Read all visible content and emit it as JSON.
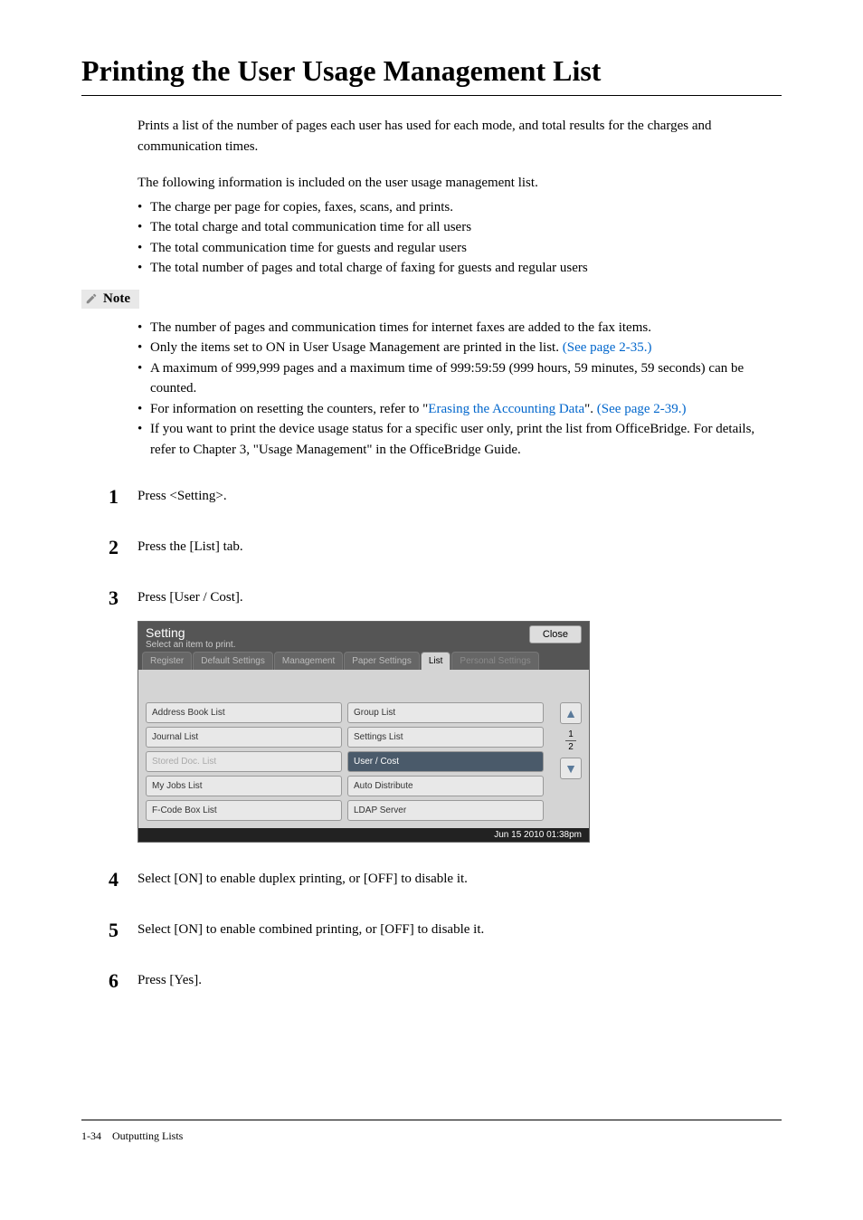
{
  "title": "Printing the User Usage Management List",
  "intro": "Prints a list of the number of pages each user has used for each mode, and total results for the charges and communication times.",
  "list_intro": "The following information is included on the user usage management list.",
  "info_bullets": [
    "The charge per page for copies, faxes, scans, and prints.",
    "The total charge and total communication time for all users",
    "The total communication time for guests and regular users",
    "The total number of pages and total charge of faxing for guests and regular users"
  ],
  "note_label": "Note",
  "note_bullets": [
    {
      "text": "The number of pages and communication times for internet faxes are added to the fax items."
    },
    {
      "text": "Only the items set to ON in User Usage Management are printed in the list. ",
      "link": "(See page 2-35.)"
    },
    {
      "text": "A maximum of 999,999 pages and a maximum time of 999:59:59 (999 hours, 59 minutes, 59 seconds) can be counted."
    },
    {
      "text": "For information on resetting the counters, refer to \"",
      "link_mid": "Erasing the Accounting Data",
      "text_after": "\". ",
      "link": "(See page 2-39.)"
    },
    {
      "text": "If you want to print the device usage status for a specific user only, print the list from OfficeBridge. For details, refer to Chapter 3, \"Usage Management\" in the OfficeBridge Guide."
    }
  ],
  "steps": [
    {
      "num": "1",
      "text": "Press <Setting>."
    },
    {
      "num": "2",
      "text": "Press the [List] tab."
    },
    {
      "num": "3",
      "text": "Press [User / Cost]."
    },
    {
      "num": "4",
      "text": "Select [ON] to enable duplex printing, or [OFF] to disable it."
    },
    {
      "num": "5",
      "text": "Select [ON] to enable combined printing, or [OFF] to disable it."
    },
    {
      "num": "6",
      "text": "Press [Yes]."
    }
  ],
  "screen": {
    "title": "Setting",
    "subtitle": "Select an item to print.",
    "close": "Close",
    "tabs": {
      "register": "Register",
      "default_settings": "Default Settings",
      "management": "Management",
      "paper_settings": "Paper Settings",
      "list": "List",
      "personal_settings": "Personal Settings"
    },
    "buttons": {
      "address_book": "Address Book List",
      "group_list": "Group List",
      "journal_list": "Journal List",
      "settings_list": "Settings List",
      "stored_doc": "Stored Doc. List",
      "user_cost": "User / Cost",
      "my_jobs": "My Jobs List",
      "auto_distribute": "Auto Distribute",
      "fcode_box": "F-Code Box List",
      "ldap_server": "LDAP Server"
    },
    "page_top": "1",
    "page_bottom": "2",
    "footer_time": "Jun 15 2010 01:38pm"
  },
  "footer": {
    "page": "1-34",
    "section": "Outputting Lists"
  }
}
